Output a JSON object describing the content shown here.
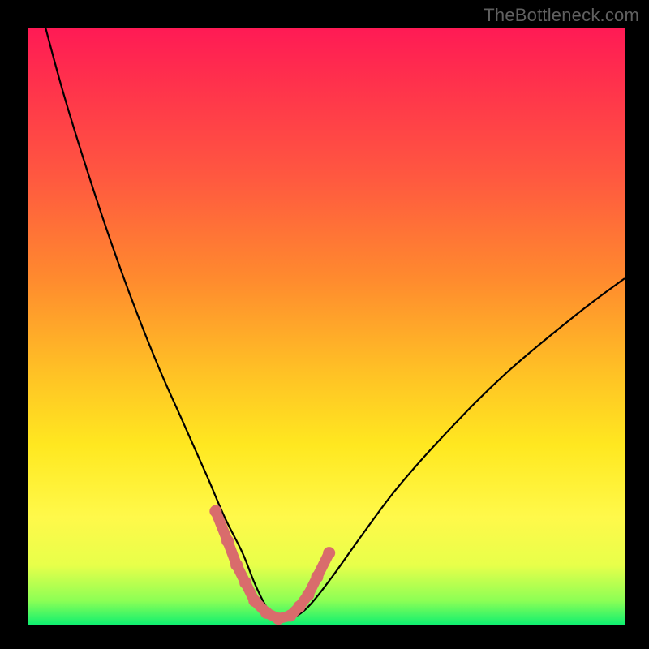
{
  "watermark": "TheBottleneck.com",
  "colors": {
    "page_bg": "#000000",
    "gradient_top": "#ff1a55",
    "gradient_bottom": "#10f070",
    "curve": "#000000",
    "marker": "#d96c6c"
  },
  "chart_data": {
    "type": "line",
    "title": "",
    "xlabel": "",
    "ylabel": "",
    "xlim": [
      0,
      100
    ],
    "ylim": [
      0,
      100
    ],
    "series": [
      {
        "name": "bottleneck-curve",
        "x": [
          3,
          6,
          10,
          14,
          18,
          22,
          26,
          30,
          33,
          36,
          38,
          40,
          42,
          44,
          47,
          51,
          56,
          62,
          70,
          80,
          92,
          100
        ],
        "y": [
          100,
          89,
          76,
          64,
          53,
          43,
          34,
          25,
          18,
          12,
          7,
          3,
          1,
          1,
          3,
          8,
          15,
          23,
          32,
          42,
          52,
          58
        ]
      }
    ],
    "markers": {
      "name": "highlight-dots",
      "x": [
        31.5,
        33.5,
        35,
        36.5,
        38,
        40,
        42,
        44,
        45.5,
        47,
        48.5,
        50.5
      ],
      "y": [
        19,
        14,
        10,
        7,
        4,
        2,
        1,
        1.5,
        3,
        5,
        8,
        12
      ]
    }
  }
}
